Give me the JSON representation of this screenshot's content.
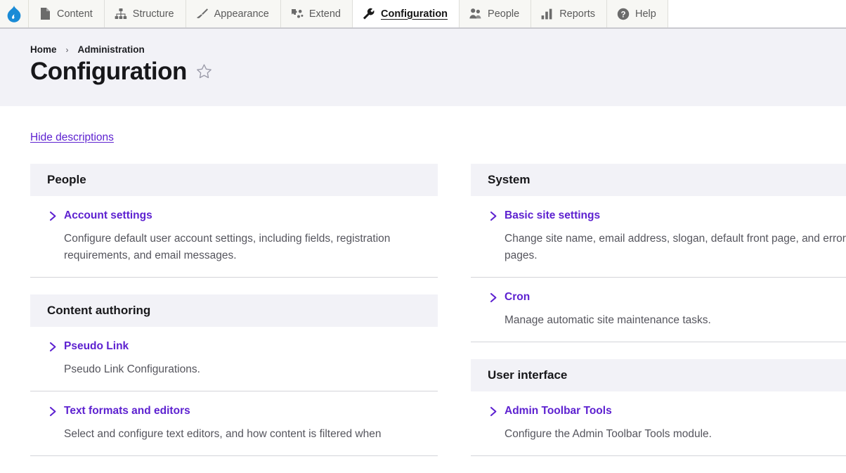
{
  "toolbar": {
    "logo": {
      "name": "drupal-logo",
      "color": "#1a8bd6"
    },
    "tabs": [
      {
        "label": "Content",
        "icon": "file-icon",
        "active": false
      },
      {
        "label": "Structure",
        "icon": "sitemap-icon",
        "active": false
      },
      {
        "label": "Appearance",
        "icon": "paintbrush-icon",
        "active": false
      },
      {
        "label": "Extend",
        "icon": "puzzle-icon",
        "active": false
      },
      {
        "label": "Configuration",
        "icon": "wrench-icon",
        "active": true
      },
      {
        "label": "People",
        "icon": "people-icon",
        "active": false
      },
      {
        "label": "Reports",
        "icon": "bar-chart-icon",
        "active": false
      },
      {
        "label": "Help",
        "icon": "question-icon",
        "active": false
      }
    ]
  },
  "header": {
    "breadcrumb": [
      {
        "label": "Home"
      },
      {
        "label": "Administration"
      }
    ],
    "separator": "›",
    "title": "Configuration",
    "star_icon": "star-outline-icon"
  },
  "main": {
    "hide_descriptions_label": "Hide descriptions",
    "accent_color": "#5d21d0",
    "panel_header_bg": "#f2f2f7",
    "left_column": [
      {
        "title": "People",
        "items": [
          {
            "label": "Account settings",
            "description": "Configure default user account settings, including fields, registration requirements, and email messages."
          }
        ]
      },
      {
        "title": "Content authoring",
        "items": [
          {
            "label": "Pseudo Link",
            "description": "Pseudo Link Configurations."
          },
          {
            "label": "Text formats and editors",
            "description": "Select and configure text editors, and how content is filtered when"
          }
        ]
      }
    ],
    "right_column": [
      {
        "title": "System",
        "items": [
          {
            "label": "Basic site settings",
            "description": "Change site name, email address, slogan, default front page, and error pages."
          },
          {
            "label": "Cron",
            "description": "Manage automatic site maintenance tasks."
          }
        ]
      },
      {
        "title": "User interface",
        "items": [
          {
            "label": "Admin Toolbar Tools",
            "description": "Configure the Admin Toolbar Tools module."
          }
        ]
      }
    ]
  }
}
